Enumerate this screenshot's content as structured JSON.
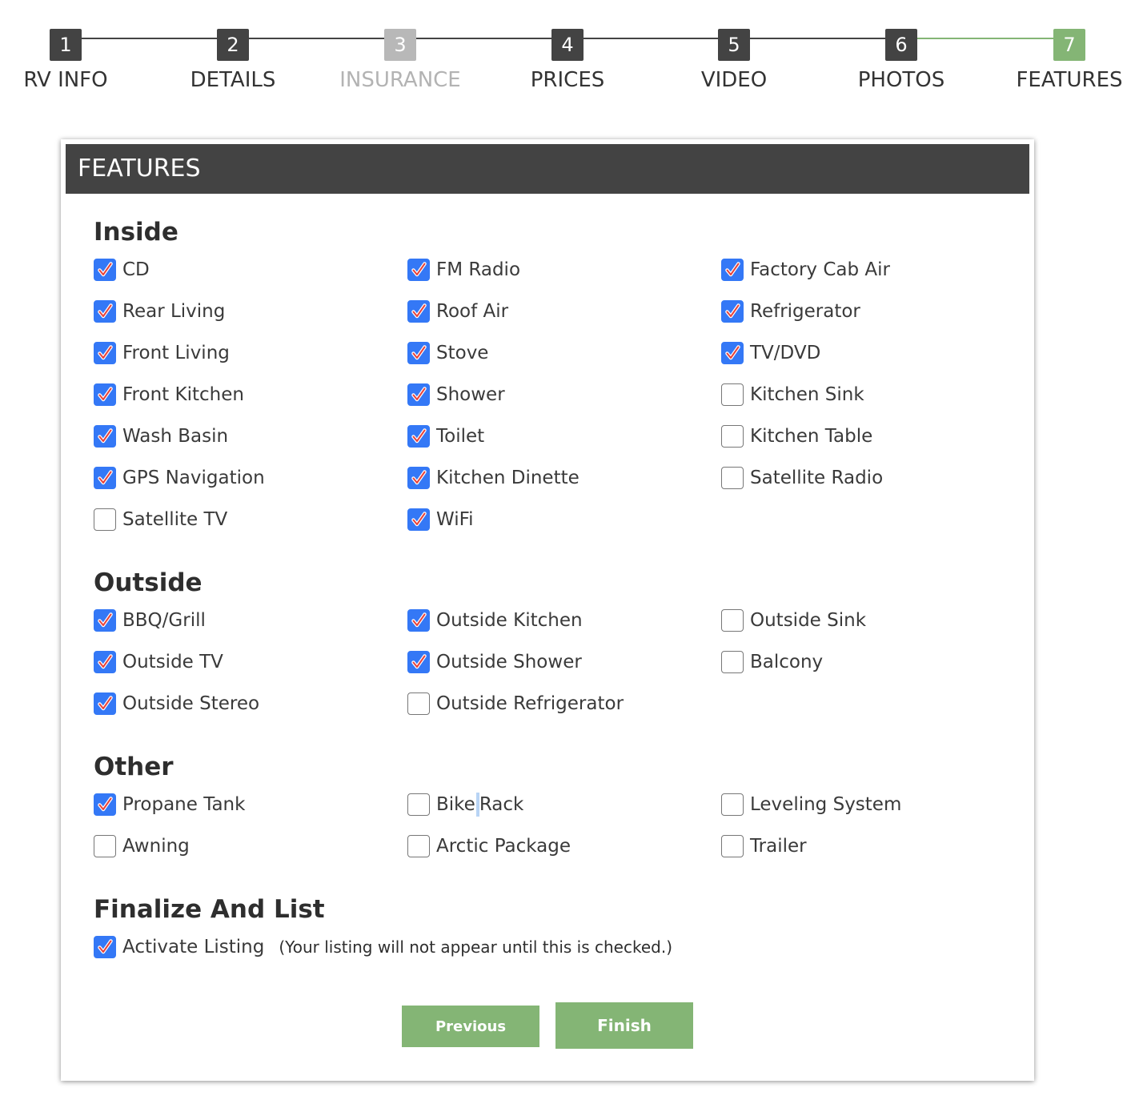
{
  "colors": {
    "step_active": "#434343",
    "step_disabled": "#b8b8b8",
    "step_current": "#84b575",
    "line_done": "#444444",
    "line_current": "#84b575",
    "label_active": "#333333",
    "label_disabled": "#b3b3b3",
    "checkbox_checked": "#3478f6",
    "checkmark": "#e8423a",
    "header_bg": "#434343",
    "button_bg": "#84b575"
  },
  "steps": [
    {
      "number": "1",
      "label": "RV INFO",
      "state": "active"
    },
    {
      "number": "2",
      "label": "DETAILS",
      "state": "active"
    },
    {
      "number": "3",
      "label": "INSURANCE",
      "state": "disabled"
    },
    {
      "number": "4",
      "label": "PRICES",
      "state": "active"
    },
    {
      "number": "5",
      "label": "VIDEO",
      "state": "active"
    },
    {
      "number": "6",
      "label": "PHOTOS",
      "state": "active"
    },
    {
      "number": "7",
      "label": "FEATURES",
      "state": "current"
    }
  ],
  "panel": {
    "title": "FEATURES"
  },
  "sections": {
    "inside": {
      "title": "Inside",
      "items": [
        {
          "label": "CD",
          "checked": true
        },
        {
          "label": "FM Radio",
          "checked": true
        },
        {
          "label": "Factory Cab Air",
          "checked": true
        },
        {
          "label": "Rear Living",
          "checked": true
        },
        {
          "label": "Roof Air",
          "checked": true
        },
        {
          "label": "Refrigerator",
          "checked": true
        },
        {
          "label": "Front Living",
          "checked": true
        },
        {
          "label": "Stove",
          "checked": true
        },
        {
          "label": "TV/DVD",
          "checked": true
        },
        {
          "label": "Front Kitchen",
          "checked": true
        },
        {
          "label": "Shower",
          "checked": true
        },
        {
          "label": "Kitchen Sink",
          "checked": false
        },
        {
          "label": "Wash Basin",
          "checked": true
        },
        {
          "label": "Toilet",
          "checked": true
        },
        {
          "label": "Kitchen Table",
          "checked": false
        },
        {
          "label": "GPS Navigation",
          "checked": true
        },
        {
          "label": "Kitchen Dinette",
          "checked": true
        },
        {
          "label": "Satellite Radio",
          "checked": false
        },
        {
          "label": "Satellite TV",
          "checked": false
        },
        {
          "label": "WiFi",
          "checked": true
        }
      ]
    },
    "outside": {
      "title": "Outside",
      "items": [
        {
          "label": "BBQ/Grill",
          "checked": true
        },
        {
          "label": "Outside Kitchen",
          "checked": true
        },
        {
          "label": "Outside Sink",
          "checked": false
        },
        {
          "label": "Outside TV",
          "checked": true
        },
        {
          "label": "Outside Shower",
          "checked": true
        },
        {
          "label": "Balcony",
          "checked": false
        },
        {
          "label": "Outside Stereo",
          "checked": true
        },
        {
          "label": "Outside Refrigerator",
          "checked": false
        }
      ]
    },
    "other": {
      "title": "Other",
      "items": [
        {
          "label": "Propane Tank",
          "checked": true
        },
        {
          "label": "Bike Rack",
          "checked": false
        },
        {
          "label": "Leveling System",
          "checked": false
        },
        {
          "label": "Awning",
          "checked": false
        },
        {
          "label": "Arctic Package",
          "checked": false
        },
        {
          "label": "Trailer",
          "checked": false
        }
      ]
    },
    "finalize": {
      "title": "Finalize And List",
      "activate_label": "Activate Listing",
      "activate_checked": true,
      "activate_note": "(Your listing will not appear until this is checked.)"
    }
  },
  "buttons": {
    "previous": "Previous",
    "finish": "Finish"
  }
}
